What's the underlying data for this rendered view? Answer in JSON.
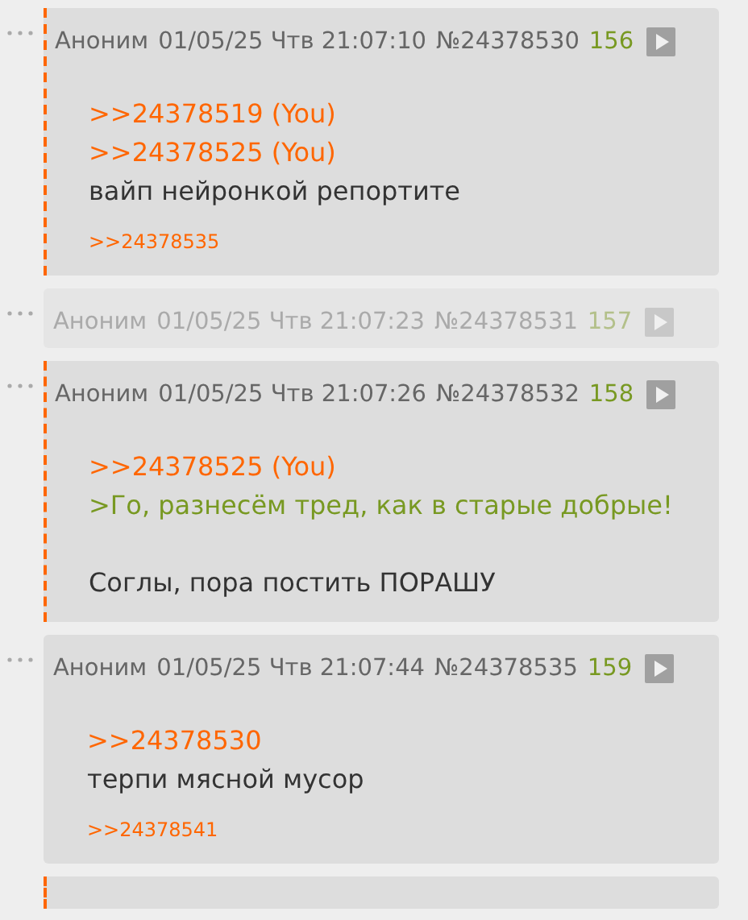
{
  "posts": [
    {
      "author": "Аноним",
      "date": "01/05/25 Чтв 21:07:10",
      "number": "№24378530",
      "index": "156",
      "highlighted": true,
      "faded": false,
      "paragraphs": [
        [
          {
            "kind": "reply_link",
            "text": ">>24378519 (You)"
          },
          {
            "kind": "reply_link",
            "text": ">>24378525 (You)"
          },
          {
            "kind": "text",
            "text": "вайп нейронкой репортите"
          }
        ]
      ],
      "replies": [
        ">>24378535"
      ]
    },
    {
      "author": "Аноним",
      "date": "01/05/25 Чтв 21:07:23",
      "number": "№24378531",
      "index": "157",
      "highlighted": false,
      "faded": true
    },
    {
      "author": "Аноним",
      "date": "01/05/25 Чтв 21:07:26",
      "number": "№24378532",
      "index": "158",
      "highlighted": true,
      "faded": false,
      "paragraphs": [
        [
          {
            "kind": "reply_link",
            "text": ">>24378525 (You)"
          },
          {
            "kind": "quote",
            "text": ">Го, разнесём тред, как в старые добрые!"
          }
        ],
        [
          {
            "kind": "text",
            "text": "Соглы, пора постить ПОРАШУ"
          }
        ]
      ]
    },
    {
      "author": "Аноним",
      "date": "01/05/25 Чтв 21:07:44",
      "number": "№24378535",
      "index": "159",
      "highlighted": false,
      "faded": false,
      "paragraphs": [
        [
          {
            "kind": "reply_link",
            "text": ">>24378530"
          },
          {
            "kind": "text",
            "text": "терпи мясной мусор"
          }
        ]
      ],
      "replies": [
        ">>24378541"
      ]
    }
  ],
  "partial_post": {
    "highlighted": true
  }
}
